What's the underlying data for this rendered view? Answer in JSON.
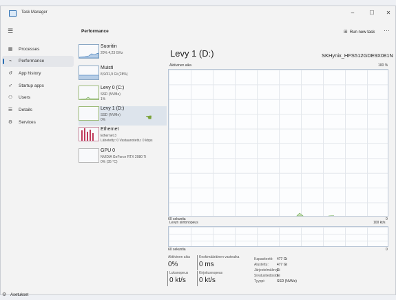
{
  "window": {
    "title": "Task Manager",
    "controls": [
      "–",
      "☐",
      "✕"
    ]
  },
  "nav": {
    "items": [
      {
        "label": "Processes",
        "icon": "grid-icon"
      },
      {
        "label": "Performance",
        "icon": "chart-icon",
        "active": true
      },
      {
        "label": "App history",
        "icon": "history-icon"
      },
      {
        "label": "Startup apps",
        "icon": "startup-icon"
      },
      {
        "label": "Users",
        "icon": "users-icon"
      },
      {
        "label": "Details",
        "icon": "details-icon"
      },
      {
        "label": "Services",
        "icon": "services-icon"
      }
    ],
    "settings": "Asetukset"
  },
  "header": {
    "title": "Performance",
    "run_new_task": "Run new task",
    "more": "···"
  },
  "devices": [
    {
      "name": "Suoritin",
      "sub1": "20% 4,23 GHz",
      "sub2": ""
    },
    {
      "name": "Muisti",
      "sub1": "8,9/31,9 Gt (28%)",
      "sub2": ""
    },
    {
      "name": "Levy 0 (C:)",
      "sub1": "SSD (NVMe)",
      "sub2": "1%"
    },
    {
      "name": "Levy 1 (D:)",
      "sub1": "SSD (NVMe)",
      "sub2": "0%",
      "selected": true
    },
    {
      "name": "Ethernet",
      "sub1": "Ethernet 3",
      "sub2": "Lähetetty: 0 Vastaanotettu: 0 kbps"
    },
    {
      "name": "GPU 0",
      "sub1": "NVIDIA GeForce RTX 2080 Ti",
      "sub2": "0% (35 °C)"
    }
  ],
  "detail": {
    "title": "Levy 1 (D:)",
    "model": "SKHynix_HFS512GDE9X081N",
    "active_graph_label": "Aktiivinen aika",
    "active_graph_max": "100 %",
    "active_graph_time": "60 sekuntia",
    "active_graph_min": "0",
    "transfer_graph_label": "Levyn siirtonopeus",
    "transfer_graph_max": "100 kt/s",
    "transfer_graph_time": "60 sekuntia",
    "transfer_graph_min": "0"
  },
  "stats": {
    "active_time_label": "Aktiivinen aika",
    "active_time_value": "0%",
    "avg_response_label": "Keskimääräinen vasteaika",
    "avg_response_value": "0 ms",
    "read_speed_label": "Lukunopeus",
    "read_speed_value": "0 kt/s",
    "write_speed_label": "Kirjoitusnopeus",
    "write_speed_value": "0 kt/s"
  },
  "properties": [
    {
      "key": "Kapasiteetti:",
      "value": "477 Gt"
    },
    {
      "key": "Alustettu:",
      "value": "477 Gt"
    },
    {
      "key": "Järjestelmälevy:",
      "value": "Ei"
    },
    {
      "key": "Sivutustiedosto:",
      "value": "Ei"
    },
    {
      "key": "Tyyppi:",
      "value": "SSD (NVMe)"
    }
  ],
  "colors": {
    "accent": "#2c6fb3",
    "disk_graph": "#6aa84f",
    "ethernet_graph": "#c0395a"
  }
}
